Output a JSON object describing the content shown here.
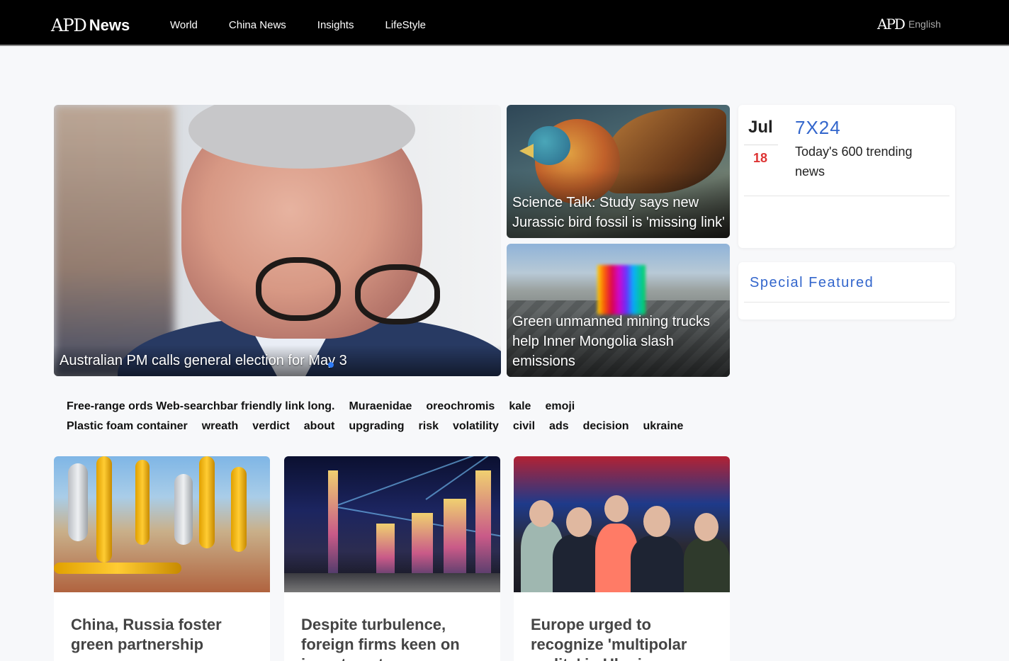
{
  "header": {
    "logo_apd": "APD",
    "logo_news": "News",
    "nav": [
      "World",
      "China News",
      "Insights",
      "LifeStyle"
    ],
    "lang_logo": "APD",
    "lang_label": "English"
  },
  "hero": {
    "title": "Australian PM calls general election for May 3"
  },
  "side_stories": [
    {
      "title": "Science Talk: Study says new Jurassic bird fossil is 'missing link'"
    },
    {
      "title": "Green unmanned mining trucks help Inner Mongolia slash emissions"
    }
  ],
  "trending": {
    "month": "Jul",
    "day": "18",
    "title": "7X24",
    "subtitle": "Today's 600 trending news"
  },
  "featured": {
    "title": "Special Featured"
  },
  "tags_row1": [
    "Free-range ords Web-searchbar friendly link long.",
    "Muraenidae",
    "oreochromis",
    "kale",
    "emoji"
  ],
  "tags_row2": [
    "Plastic foam container",
    "wreath",
    "verdict",
    "about",
    "upgrading",
    "risk",
    "volatility",
    "civil",
    "ads",
    "decision",
    "ukraine"
  ],
  "cards": [
    {
      "title": "China, Russia foster green partnership"
    },
    {
      "title": "Despite turbulence, foreign firms keen on investment"
    },
    {
      "title": "Europe urged to recognize 'multipolar reality' in Ukraine"
    }
  ],
  "colors": {
    "accent_blue": "#3366cc",
    "date_red": "#dd3333",
    "header_bg": "#000000"
  }
}
